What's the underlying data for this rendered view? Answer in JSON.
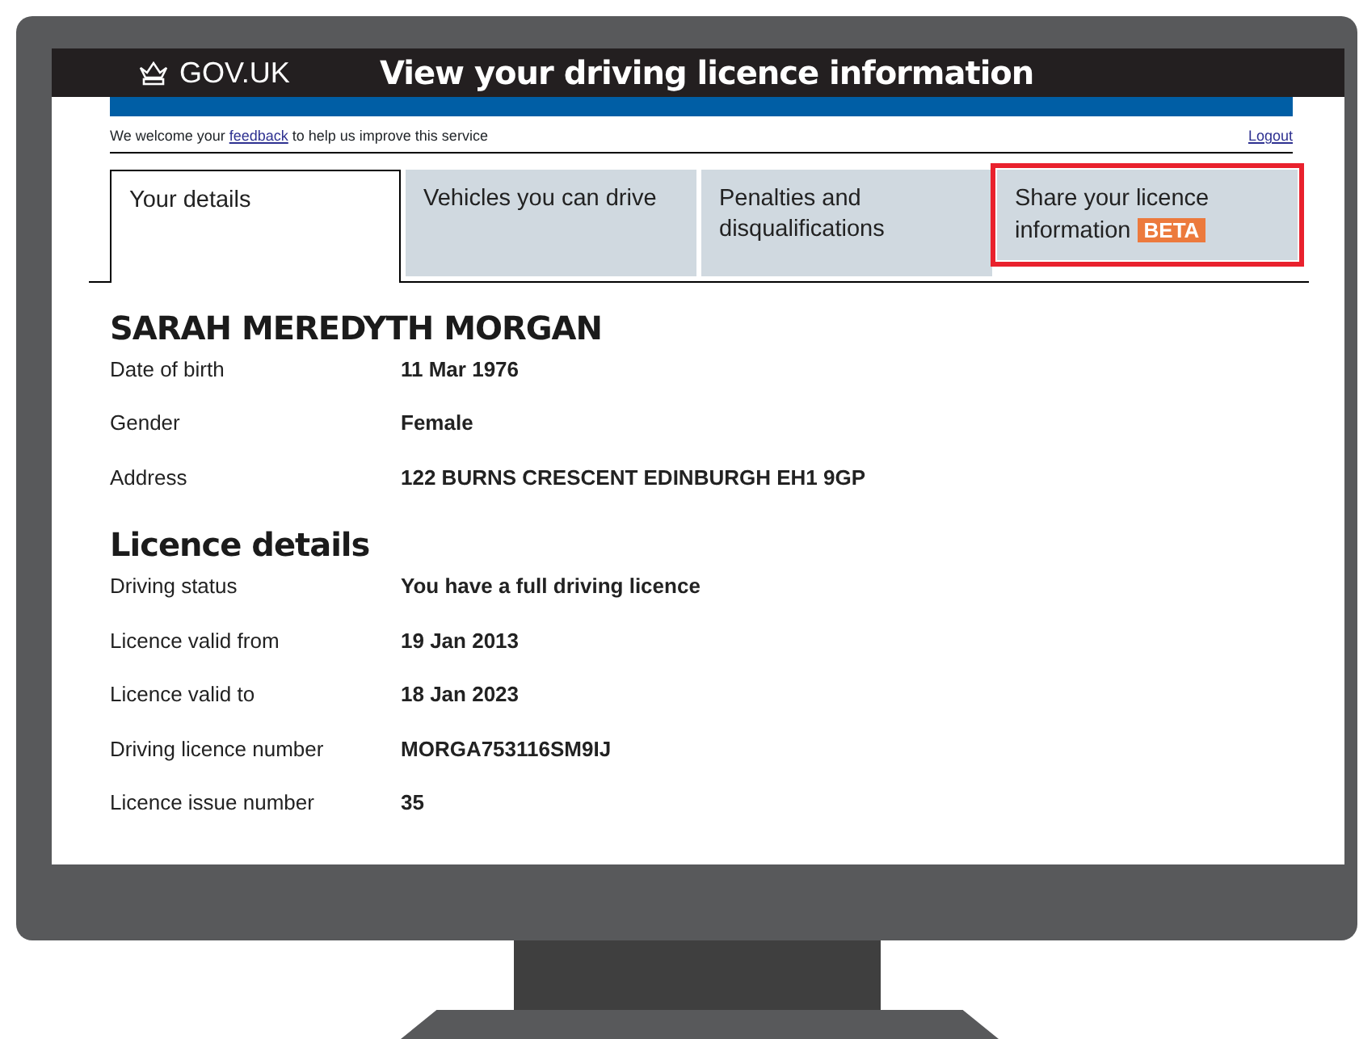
{
  "header": {
    "logo_text": "GOV.UK",
    "title": "View your driving licence information"
  },
  "feedback": {
    "link": "feedback",
    "before": "We welcome your ",
    "after": " to help us improve this service"
  },
  "logout": "Logout",
  "tabs": [
    {
      "label": "Your details",
      "selected": true,
      "highlighted": false
    },
    {
      "label": "Vehicles you can drive",
      "selected": false,
      "highlighted": false
    },
    {
      "label": "Penalties and disqualifications",
      "selected": false,
      "highlighted": false
    },
    {
      "label": "Share your licence information",
      "badge": "BETA",
      "selected": false,
      "highlighted": true
    }
  ],
  "sections": [
    {
      "heading": "SARAH MEREDYTH MORGAN",
      "rows": [
        {
          "label": "Date of birth",
          "value": "11 Mar 1976"
        },
        {
          "label": "Gender",
          "value": "Female"
        },
        {
          "label": "Address",
          "value": "122 BURNS CRESCENT EDINBURGH EH1 9GP"
        }
      ]
    },
    {
      "heading": "Licence details",
      "rows": [
        {
          "label": "Driving status",
          "value": "You have a full driving licence"
        },
        {
          "label": "Licence valid from",
          "value": "19 Jan 2013"
        },
        {
          "label": "Licence valid to",
          "value": "18 Jan 2023"
        },
        {
          "label": "Driving licence number",
          "value": "MORGA753116SM9IJ"
        },
        {
          "label": "Licence issue number",
          "value": "35"
        }
      ]
    }
  ]
}
